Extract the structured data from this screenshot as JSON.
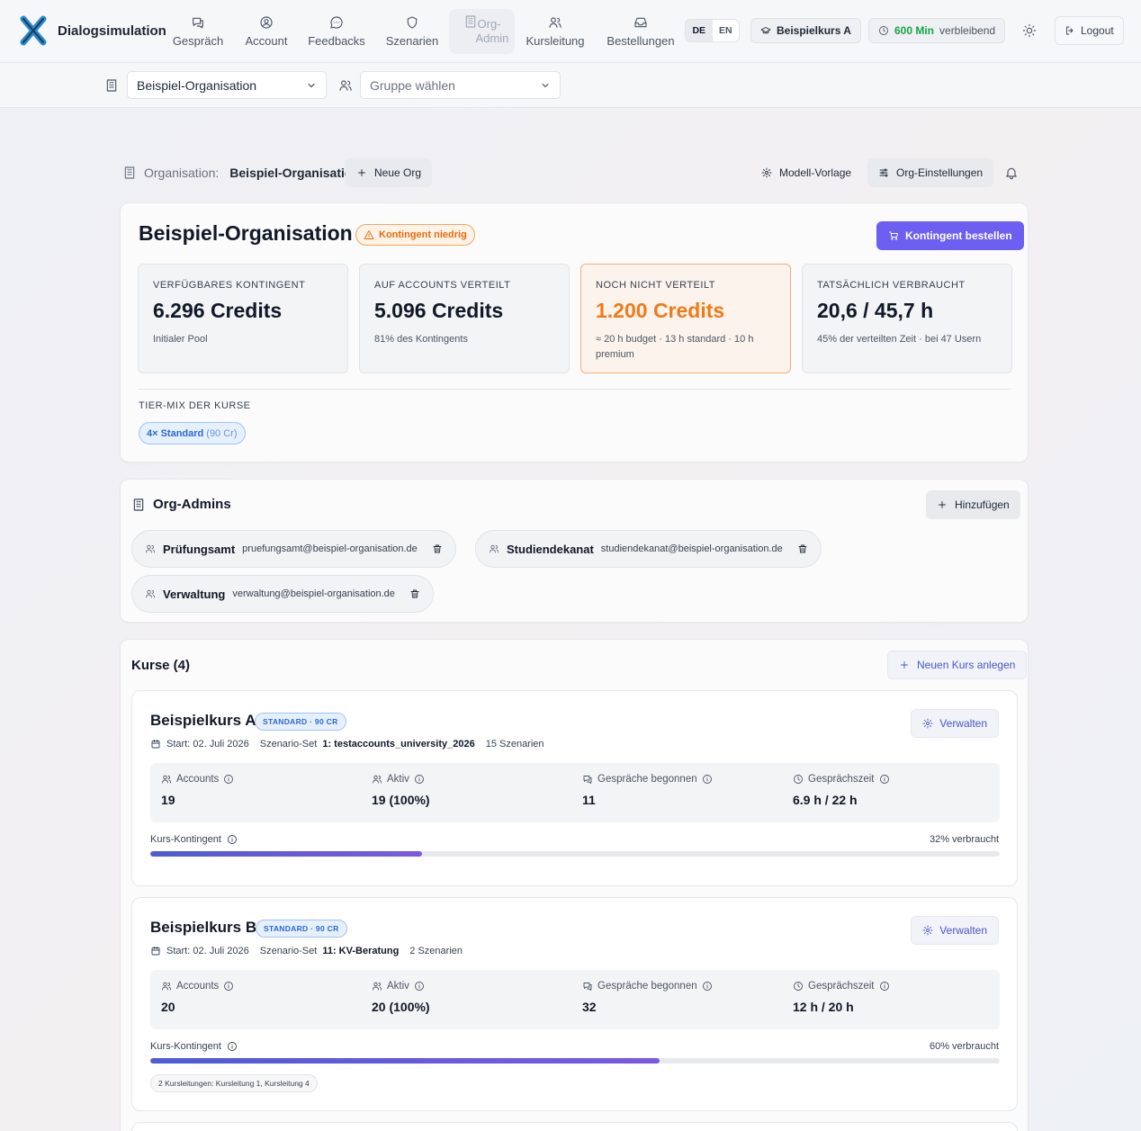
{
  "header": {
    "brand": "Dialogsimulation",
    "nav": [
      {
        "label": "Gespräch",
        "icon": "chat-icon"
      },
      {
        "label": "Account",
        "icon": "user-circle-icon"
      },
      {
        "label": "Feedbacks",
        "icon": "message-icon"
      },
      {
        "label": "Szenarien",
        "icon": "shield-icon"
      },
      {
        "label": "Org-Admin",
        "icon": "building-icon"
      },
      {
        "label": "Kursleitung",
        "icon": "users-icon"
      },
      {
        "label": "Bestellungen",
        "icon": "inbox-icon"
      }
    ],
    "lang": [
      "DE",
      "EN"
    ],
    "course_label": "Beispielkurs A",
    "minutes_value": "600 Min",
    "minutes_suffix": "verbleibend",
    "logout": "Logout",
    "colors": {
      "accent": "#6d5ff2",
      "minutes": "#16a34a",
      "warn": "#f07a18"
    }
  },
  "subbar": {
    "org_select": "Beispiel-Organisation",
    "group_select_placeholder": "Gruppe wählen"
  },
  "orgrow": {
    "label": "Organisation:",
    "org_name": "Beispiel-Organisation",
    "new_org": "Neue Org",
    "model_template": "Modell-Vorlage",
    "org_settings": "Org-Einstellungen"
  },
  "overview": {
    "title": "Beispiel-Organisation",
    "warning_badge": "Kontingent niedrig",
    "order_button": "Kontingent bestellen",
    "stats": [
      {
        "caption": "Verfügbares Kontingent",
        "value": "6.296 Credits",
        "sub": "Initialer Pool"
      },
      {
        "caption": "Auf Accounts verteilt",
        "value": "5.096 Credits",
        "sub": "81% des Kontingents"
      },
      {
        "caption": "Noch nicht verteilt",
        "value": "1.200 Credits",
        "sub": "≈ 20 h budget · 13 h standard · 10 h premium"
      },
      {
        "caption": "Tatsächlich verbraucht",
        "value": "20,6 / 45,7 h",
        "sub": "45% der verteilten Zeit · bei 47 Usern"
      }
    ],
    "tier_caption": "Tier-Mix der Kurse",
    "tier_chip_main": "4× Standard",
    "tier_chip_sub": "(90 Cr)"
  },
  "admins": {
    "title": "Org-Admins",
    "add": "Hinzufügen",
    "items": [
      {
        "name": "Prüfungsamt",
        "email": "pruefungsamt@beispiel-organisation.de"
      },
      {
        "name": "Studiendekanat",
        "email": "studiendekanat@beispiel-organisation.de"
      },
      {
        "name": "Verwaltung",
        "email": "verwaltung@beispiel-organisation.de"
      }
    ]
  },
  "courses": {
    "title": "Kurse (4)",
    "new_course": "Neuen Kurs anlegen",
    "items": [
      {
        "name": "Beispielkurs A",
        "tier": "STANDARD · 90 CR",
        "manage": "Verwalten",
        "start": "Start: 02. Juli 2026",
        "set_prefix": "Szenario-Set",
        "set_name": "1: testaccounts_university_2026",
        "scenarios": "15 Szenarien",
        "metrics": [
          {
            "label": "Accounts",
            "value": "19"
          },
          {
            "label": "Aktiv",
            "value": "19 (100%)"
          },
          {
            "label": "Gespräche begonnen",
            "value": "11"
          },
          {
            "label": "Gesprächszeit",
            "value": "6.9 h / 22 h"
          }
        ],
        "quota_label": "Kurs-Kontingent",
        "quota_pct_text": "32% verbraucht",
        "quota_fraction": 0.32
      },
      {
        "name": "Beispielkurs B",
        "tier": "STANDARD · 90 CR",
        "manage": "Verwalten",
        "start": "Start: 02. Juli 2026",
        "set_prefix": "Szenario-Set",
        "set_name": "11: KV-Beratung",
        "scenarios": "2 Szenarien",
        "metrics": [
          {
            "label": "Accounts",
            "value": "20"
          },
          {
            "label": "Aktiv",
            "value": "20 (100%)"
          },
          {
            "label": "Gespräche begonnen",
            "value": "32"
          },
          {
            "label": "Gesprächszeit",
            "value": "12 h / 20 h"
          }
        ],
        "quota_label": "Kurs-Kontingent",
        "quota_pct_text": "60% verbraucht",
        "quota_fraction": 0.6,
        "leads": "2 Kursleitungen: Kursleitung 1, Kursleitung 4"
      }
    ]
  }
}
